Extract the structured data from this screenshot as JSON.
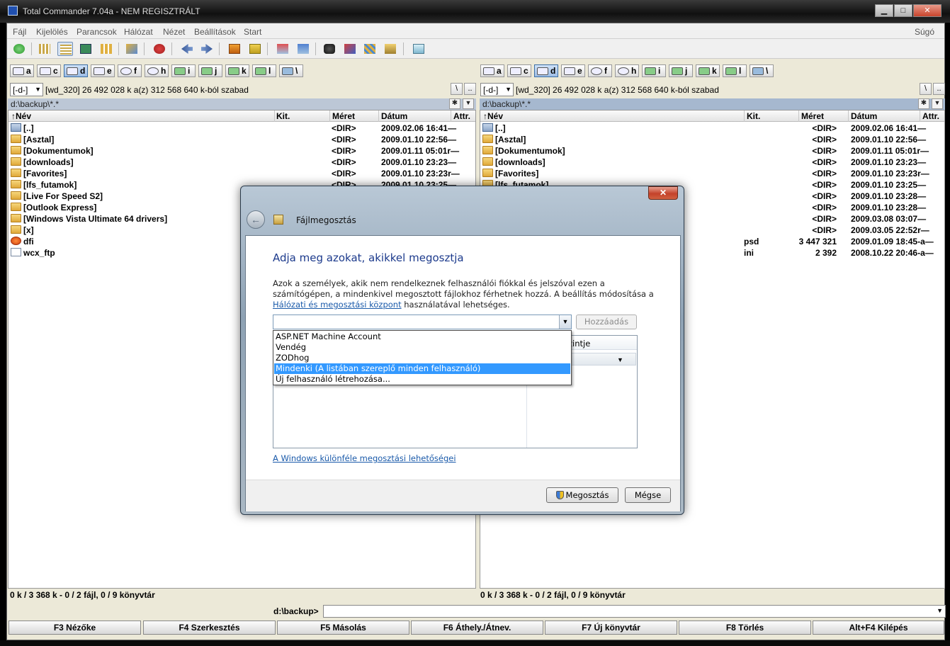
{
  "window": {
    "title": "Total Commander 7.04a - NEM REGISZTRÁLT",
    "min": "▁",
    "max": "□",
    "close": "✕"
  },
  "menu": {
    "items": [
      "Fájl",
      "Kijelölés",
      "Parancsok",
      "Hálózat",
      "Nézet",
      "Beállítások",
      "Start"
    ],
    "help": "Súgó"
  },
  "drives": [
    "a",
    "c",
    "d",
    "e",
    "f",
    "h",
    "i",
    "j",
    "k",
    "l",
    "\\"
  ],
  "left": {
    "drive": "[-d-]",
    "info": "[wd_320]  26 492 028 k a(z) 312 568 640 k-ból szabad",
    "path": "d:\\backup\\*.*",
    "columns": {
      "name": "↑Név",
      "ext": "Kit.",
      "size": "Méret",
      "date": "Dátum",
      "attr": "Attr."
    },
    "rows": [
      {
        "icon": "up-icon",
        "name": "[..]",
        "ext": "",
        "size": "<DIR>",
        "date": "2009.02.06 16:41—"
      },
      {
        "icon": "folder-icon",
        "name": "[Asztal]",
        "ext": "",
        "size": "<DIR>",
        "date": "2009.01.10 22:56—"
      },
      {
        "icon": "folder-icon",
        "name": "[Dokumentumok]",
        "ext": "",
        "size": "<DIR>",
        "date": "2009.01.11 05:01r—"
      },
      {
        "icon": "folder-icon",
        "name": "[downloads]",
        "ext": "",
        "size": "<DIR>",
        "date": "2009.01.10 23:23—"
      },
      {
        "icon": "folder-icon",
        "name": "[Favorites]",
        "ext": "",
        "size": "<DIR>",
        "date": "2009.01.10 23:23r—"
      },
      {
        "icon": "folder-icon",
        "name": "[lfs_futamok]",
        "ext": "",
        "size": "<DIR>",
        "date": "2009.01.10 23:25—"
      },
      {
        "icon": "folder-icon",
        "name": "[Live For Speed S2]",
        "ext": "",
        "size": "",
        "date": ""
      },
      {
        "icon": "folder-icon",
        "name": "[Outlook Express]",
        "ext": "",
        "size": "",
        "date": ""
      },
      {
        "icon": "folder-icon",
        "name": "[Windows Vista Ultimate 64 drivers]",
        "ext": "",
        "size": "",
        "date": ""
      },
      {
        "icon": "folder-icon",
        "name": "[x]",
        "ext": "",
        "size": "",
        "date": ""
      },
      {
        "icon": "app-file-icon",
        "name": "dfi",
        "ext": "",
        "size": "",
        "date": ""
      },
      {
        "icon": "file-icon",
        "name": "wcx_ftp",
        "ext": "",
        "size": "",
        "date": ""
      }
    ],
    "status": "0 k / 3 368 k - 0 / 2 fájl, 0 / 9 könyvtár"
  },
  "right": {
    "drive": "[-d-]",
    "info": "[wd_320]  26 492 028 k a(z) 312 568 640 k-ból szabad",
    "path": "d:\\backup\\*.*",
    "columns": {
      "name": "↑Név",
      "ext": "Kit.",
      "size": "Méret",
      "date": "Dátum",
      "attr": "Attr."
    },
    "rows": [
      {
        "icon": "up-icon",
        "name": "[..]",
        "ext": "",
        "size": "<DIR>",
        "date": "2009.02.06 16:41—"
      },
      {
        "icon": "folder-icon",
        "name": "[Asztal]",
        "ext": "",
        "size": "<DIR>",
        "date": "2009.01.10 22:56—"
      },
      {
        "icon": "folder-icon",
        "name": "[Dokumentumok]",
        "ext": "",
        "size": "<DIR>",
        "date": "2009.01.11 05:01r—"
      },
      {
        "icon": "folder-icon",
        "name": "[downloads]",
        "ext": "",
        "size": "<DIR>",
        "date": "2009.01.10 23:23—"
      },
      {
        "icon": "folder-icon",
        "name": "[Favorites]",
        "ext": "",
        "size": "<DIR>",
        "date": "2009.01.10 23:23r—"
      },
      {
        "icon": "folder-icon",
        "name": "[lfs_futamok]",
        "ext": "",
        "size": "<DIR>",
        "date": "2009.01.10 23:25—"
      },
      {
        "icon": "folder-icon",
        "name": "",
        "ext": "",
        "size": "<DIR>",
        "date": "2009.01.10 23:28—"
      },
      {
        "icon": "folder-icon",
        "name": "",
        "ext": "",
        "size": "<DIR>",
        "date": "2009.01.10 23:28—"
      },
      {
        "icon": "folder-icon",
        "name": "",
        "ext": "",
        "size": "<DIR>",
        "date": "2009.03.08 03:07—"
      },
      {
        "icon": "folder-icon",
        "name": "",
        "ext": "",
        "size": "<DIR>",
        "date": "2009.03.05 22:52r—"
      },
      {
        "icon": "",
        "name": "",
        "ext": "psd",
        "size": "3 447 321",
        "date": "2009.01.09 18:45-a—"
      },
      {
        "icon": "",
        "name": "",
        "ext": "ini",
        "size": "2 392",
        "date": "2008.10.22 20:46-a—"
      }
    ],
    "status": "0 k / 3 368 k - 0 / 2 fájl, 0 / 9 könyvtár"
  },
  "cmdline": {
    "label": "d:\\backup>",
    "value": ""
  },
  "fkeys": [
    "F3 Nézőke",
    "F4 Szerkesztés",
    "F5 Másolás",
    "F6 Áthely./Átnev.",
    "F7 Új könyvtár",
    "F8 Törlés",
    "Alt+F4 Kilépés"
  ],
  "dialog": {
    "title": "Fájlmegosztás",
    "close": "✕",
    "heading": "Adja meg azokat, akikkel megosztja",
    "desc_before": "Azok a személyek, akik nem rendelkeznek felhasználói fiókkal és jelszóval ezen a számítógépen, a mindenkivel megosztott fájlokhoz férhetnek hozzá. A beállítás módosítása a ",
    "desc_link": "Hálózati és megosztási központ",
    "desc_after": " használatával lehetséges.",
    "combo_value": "",
    "add_button": "Hozzáadás",
    "level_header": "zintje",
    "dropdown_options": [
      "ASP.NET Machine Account",
      "Vendég",
      "ZODhog",
      "Mindenki (A listában szereplő minden felhasználó)",
      "Új felhasználó létrehozása..."
    ],
    "dropdown_highlighted_index": 3,
    "footer_link": "A Windows különféle megosztási lehetőségei",
    "share_button": "Megosztás",
    "cancel_button": "Mégse"
  }
}
